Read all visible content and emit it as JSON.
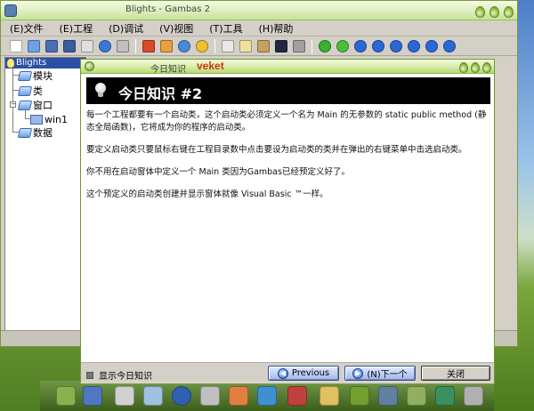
{
  "main_window": {
    "title": "Blights - Gambas 2",
    "menu": [
      {
        "label": "(E)文件"
      },
      {
        "label": "(E)工程"
      },
      {
        "label": "(D)调试"
      },
      {
        "label": "(V)视图"
      },
      {
        "label": "(T)工具"
      },
      {
        "label": "(H)帮助"
      }
    ],
    "toolbar_icons": [
      "new-file-icon",
      "open-folder-icon",
      "save-icon",
      "save-all-icon",
      "properties-icon",
      "compile-icon",
      "make-icon",
      "package-icon",
      "translate-icon",
      "settings-icon",
      "form-icon",
      "edit-icon",
      "tools-icon",
      "screen-icon",
      "search-icon",
      "run-icon",
      "pause-icon",
      "stop-icon",
      "step-icon",
      "step-over-icon",
      "step-out-icon",
      "breakpoint-icon",
      "help-icon"
    ],
    "project": {
      "name": "Blights",
      "tree": [
        {
          "label": "模块"
        },
        {
          "label": "类"
        },
        {
          "label": "窗口"
        },
        {
          "label": "win1"
        },
        {
          "label": "数据"
        }
      ]
    }
  },
  "dialog": {
    "title": "今日知识",
    "title_extra": "veket",
    "heading": "今日知识 #2",
    "paragraphs": [
      "每一个工程都要有一个启动类，这个启动类必须定义一个名为 Main 的无参数的 static public method (静态全局函数)，它将成为你的程序的启动类。",
      "要定义启动类只要鼠标右键在工程目录数中点击要设为启动类的类并在弹出的右键菜单中击选启动类。",
      "你不用在启动窗体中定义一个 Main 类因为Gambas已经预定义好了。",
      "这个预定义的启动类创建并显示窗体就像 Visual Basic ™一样。"
    ],
    "show_tips_label": "显示今日知识",
    "previous_label": "Previous",
    "next_label": "(N)下一个",
    "close_label": "关闭"
  },
  "colors": {
    "accent_green": "#8dba45",
    "selection_blue": "#2b4fa6",
    "title_red": "#c63a10"
  }
}
